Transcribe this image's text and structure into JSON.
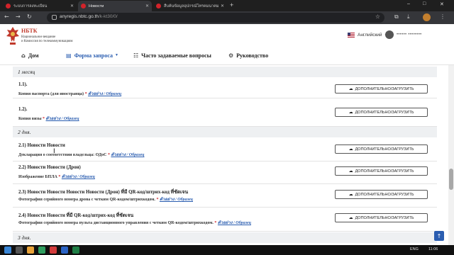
{
  "browser": {
    "tabs": [
      {
        "label": "ระบบการลงทะเบียน",
        "active": false
      },
      {
        "label": "Новости",
        "active": true
      },
      {
        "label": "สืบค้นข้อมูลอุปกรณ์โทรคมนาคม",
        "active": false
      }
    ],
    "new_tab": "+",
    "url_host": "anyregis.nbtc.go.th",
    "url_path": "/k-kt30/0/",
    "window_controls": [
      "–",
      "□",
      "✕"
    ]
  },
  "site": {
    "brand_title": "НБТК",
    "brand_line1": "Национальное вещание",
    "brand_line2": "и Комиссия по телекоммуникациям",
    "language": "Английский",
    "user_name": "•••••• ••••••••"
  },
  "nav": {
    "home": "Дом",
    "request_form": "Форма запроса",
    "faq": "Часто задаваемые вопросы",
    "guide": "Руководство"
  },
  "upload_label": "ДОПОЛНИТЕЛЬНО/ЗАГРУЗИТЬ",
  "sample_link": "ตัวอย่าง / Образец",
  "sections": [
    {
      "title": "1 месяц"
    },
    {
      "title": "2 дня."
    },
    {
      "title": "3 дня."
    }
  ],
  "rows": [
    {
      "number": "1.1).",
      "desc": "Копия паспорта (для иностранца)"
    },
    {
      "number": "1.2).",
      "desc": "Копия визы"
    },
    {
      "number": "2.1) Новости Новости",
      "desc": "Декларация о соответствии владельца: ОДоС"
    },
    {
      "number": "2.2) Новости Новости (Дрон)",
      "desc": "Изображение БПЛА"
    },
    {
      "number": "2.3) Новости Новости Новости Новости (Дрон) ที่มี QR-код/штрих-код ที่ชัดเจน",
      "desc": "Фотография серийного номера дрона с четким QR-кодом/штрихкодом."
    },
    {
      "number": "2.4) Новости Новости ที่มี QR-код/штрих-код ที่ชัดเจน",
      "desc": "Фотография серийного номера пульта дистанционного управления с четким QR-кодом/штрихкодом."
    }
  ],
  "taskbar": {
    "language": "ENG",
    "time": "11:06"
  },
  "colors": {
    "accent": "#2a5db0",
    "required": "#d0252b",
    "brand": "#c0392b"
  }
}
